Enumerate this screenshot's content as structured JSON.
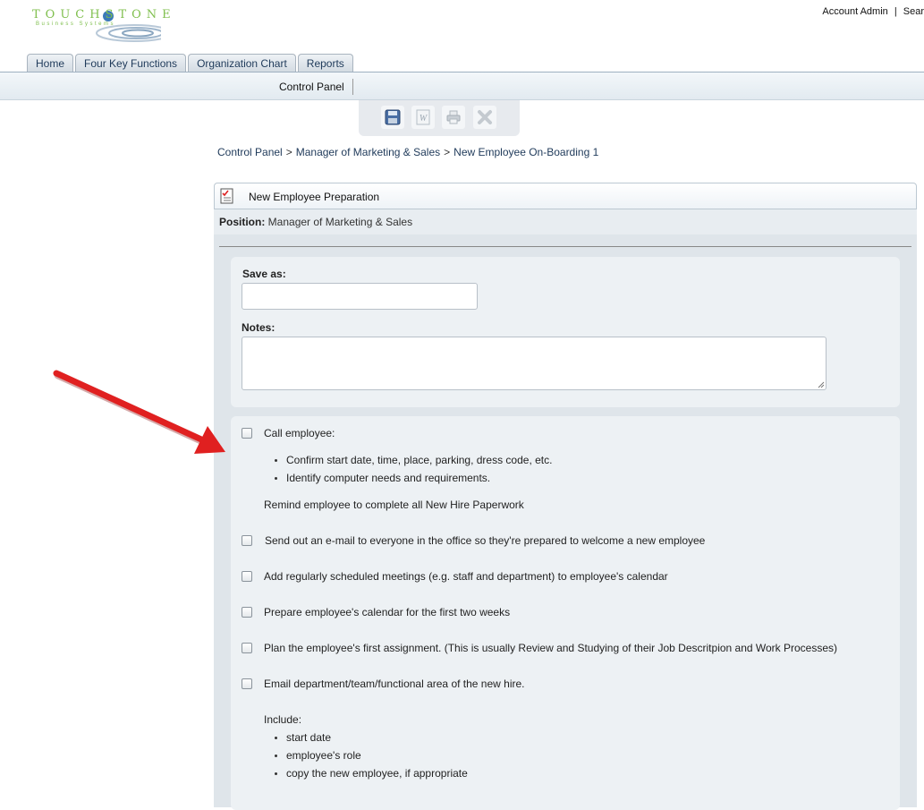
{
  "logo": {
    "main": "TOUCHSTONE",
    "sub": "Business Systems"
  },
  "top_links": {
    "account": "Account Admin",
    "separator": "|",
    "search": "Sear"
  },
  "tabs": [
    {
      "label": "Home"
    },
    {
      "label": "Four Key Functions"
    },
    {
      "label": "Organization Chart"
    },
    {
      "label": "Reports"
    }
  ],
  "subnav": {
    "control_panel": "Control Panel"
  },
  "toolbar": {
    "icons": [
      "save-icon",
      "word-export-icon",
      "print-icon",
      "delete-icon"
    ]
  },
  "breadcrumb": {
    "items": [
      "Control Panel",
      "Manager of Marketing & Sales",
      "New Employee On-Boarding 1"
    ],
    "separator": ">"
  },
  "card": {
    "title": "New Employee Preparation",
    "position_label": "Position:",
    "position_value": "Manager of Marketing & Sales"
  },
  "form": {
    "save_as_label": "Save as:",
    "save_as_value": "",
    "notes_label": "Notes:",
    "notes_value": ""
  },
  "tasks": {
    "call": {
      "label": "Call employee:",
      "checked": false,
      "bullets": [
        "Confirm start date, time, place, parking, dress code, etc.",
        "Identify computer needs and requirements."
      ],
      "note": "Remind employee to complete all New Hire Paperwork"
    },
    "email_office": {
      "label": "Send out an e-mail to everyone in the office so they're prepared to welcome a new employee",
      "checked": false
    },
    "meetings": {
      "label": "Add regularly scheduled meetings (e.g. staff and department) to employee's calendar",
      "checked": false
    },
    "calendar": {
      "label": "Prepare employee's calendar for the first two weeks",
      "checked": false
    },
    "assignment": {
      "label": "Plan the employee's first assignment. (This is usually Review and Studying of their Job Descritpion and Work Processes)",
      "checked": false
    },
    "email_dept": {
      "label": "Email department/team/functional area of the new hire.",
      "checked": false,
      "include_label": "Include:",
      "bullets": [
        "start date",
        "employee's role",
        "copy the new employee, if appropriate"
      ]
    }
  },
  "colors": {
    "accent_red": "#e02020",
    "logo_green": "#7fbf4d",
    "link_blue": "#1f3a5a"
  }
}
